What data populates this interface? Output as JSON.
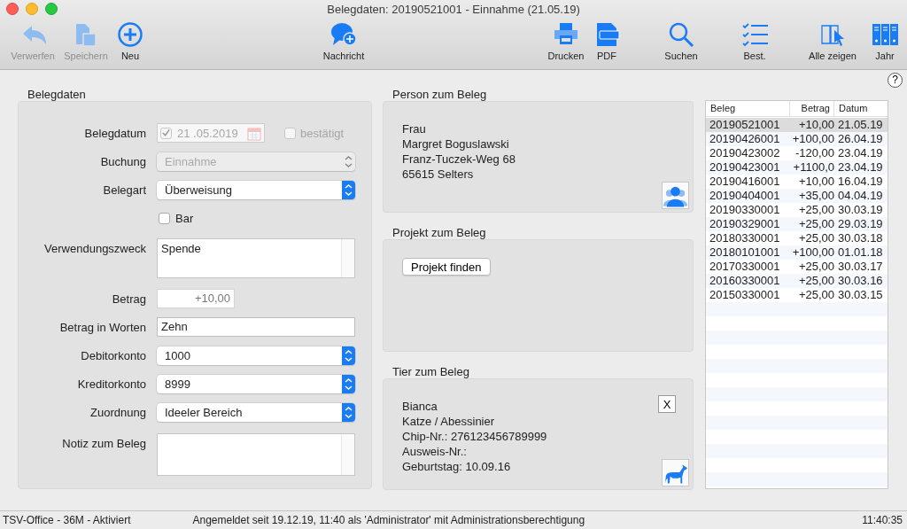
{
  "window": {
    "title": "Belegdaten: 20190521001 - Einnahme (21.05.19)"
  },
  "toolbar": [
    {
      "label": "Verwerfen",
      "disabled": true
    },
    {
      "label": "Speichern",
      "disabled": true
    },
    {
      "label": "Neu",
      "disabled": false
    },
    {
      "label": "Nachricht",
      "disabled": false
    },
    {
      "label": "Drucken",
      "disabled": false
    },
    {
      "label": "PDF",
      "disabled": false
    },
    {
      "label": "Suchen",
      "disabled": false
    },
    {
      "label": "Best.",
      "disabled": false
    },
    {
      "label": "Alle zeigen",
      "disabled": false
    },
    {
      "label": "Jahr",
      "disabled": false
    }
  ],
  "help_button": {
    "label": "?"
  },
  "belegdaten": {
    "title": "Belegdaten",
    "fields": [
      {
        "kind": "date",
        "label": "Belegdatum",
        "value": "21 .05.2019",
        "checked": true,
        "disabled": true,
        "confirm": {
          "label": "bestätigt",
          "checked": false,
          "disabled": true
        }
      },
      {
        "kind": "select",
        "label": "Buchung",
        "value": "Einnahme",
        "disabled": true
      },
      {
        "kind": "select",
        "label": "Belegart",
        "value": "Überweisung",
        "disabled": false
      },
      {
        "kind": "checkbox",
        "label": "Bar",
        "checked": false
      },
      {
        "kind": "textarea",
        "label": "Verwendungszweck",
        "value": "Spende"
      },
      {
        "kind": "amount",
        "label": "Betrag",
        "value": "+10,00"
      },
      {
        "kind": "text",
        "label": "Betrag in Worten",
        "value": "Zehn"
      },
      {
        "kind": "select",
        "label": "Debitorkonto",
        "value": "1000",
        "disabled": false
      },
      {
        "kind": "select",
        "label": "Kreditorkonto",
        "value": "8999",
        "disabled": false
      },
      {
        "kind": "select",
        "label": "Zuordnung",
        "value": "Ideeler Bereich",
        "disabled": false
      },
      {
        "kind": "textarea",
        "label": "Notiz zum Beleg"
      }
    ]
  },
  "person": {
    "title": "Person zum Beleg",
    "lines": [
      "Frau",
      "Margret Boguslawski",
      "Franz-Tuczek-Weg 68",
      "65615 Selters"
    ]
  },
  "project": {
    "title": "Projekt zum Beleg",
    "button": "Projekt finden"
  },
  "animal": {
    "title": "Tier zum Beleg",
    "lines": [
      "Bianca",
      "Katze / Abessinier",
      "Chip-Nr.: 276123456789999",
      "Ausweis-Nr.:",
      "Geburtstag: 10.09.16"
    ],
    "remove_button": "X"
  },
  "table": {
    "columns": [
      "Beleg",
      "Betrag",
      "Datum"
    ],
    "rows": [
      {
        "cells": [
          "20190521001",
          "+10,00",
          "21.05.19"
        ],
        "selected": true
      },
      {
        "cells": [
          "20190426001",
          "+100,00",
          "26.04.19"
        ],
        "selected": false
      },
      {
        "cells": [
          "20190423002",
          "-120,00",
          "23.04.19"
        ],
        "selected": false
      },
      {
        "cells": [
          "20190423001",
          "+1100,0",
          "23.04.19"
        ],
        "selected": false
      },
      {
        "cells": [
          "20190416001",
          "+10,00",
          "16.04.19"
        ],
        "selected": false
      },
      {
        "cells": [
          "20190404001",
          "+35,00",
          "04.04.19"
        ],
        "selected": false
      },
      {
        "cells": [
          "20190330001",
          "+25,00",
          "30.03.19"
        ],
        "selected": false
      },
      {
        "cells": [
          "20190329001",
          "+25,00",
          "29.03.19"
        ],
        "selected": false
      },
      {
        "cells": [
          "20180330001",
          "+25,00",
          "30.03.18"
        ],
        "selected": false
      },
      {
        "cells": [
          "20180101001",
          "+100,00",
          "01.01.18"
        ],
        "selected": false
      },
      {
        "cells": [
          "20170330001",
          "+25,00",
          "30.03.17"
        ],
        "selected": false
      },
      {
        "cells": [
          "20160330001",
          "+25,00",
          "30.03.16"
        ],
        "selected": false
      },
      {
        "cells": [
          "20150330001",
          "+25,00",
          "30.03.15"
        ],
        "selected": false
      }
    ]
  },
  "status_bar": {
    "app": "TSV-Office - 36M - Aktiviert",
    "message": "Angemeldet seit 19.12.19, 11:40 als 'Administrator' mit Administrationsberechtigung",
    "time": "11:40:35"
  }
}
